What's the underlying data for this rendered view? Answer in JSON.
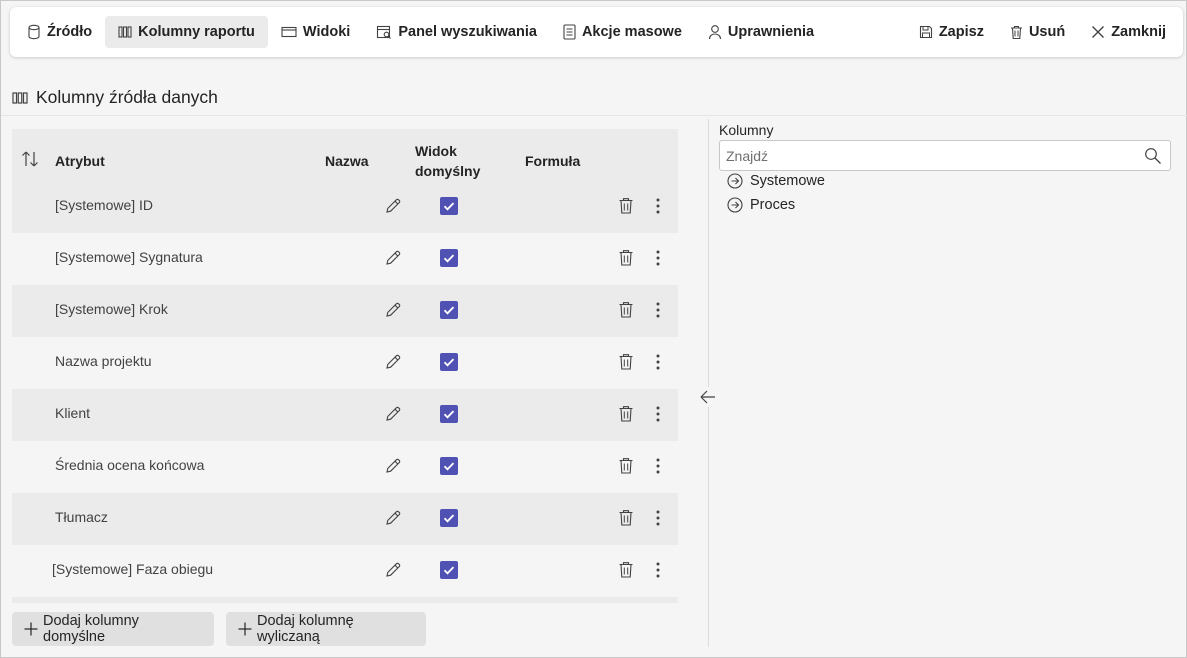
{
  "toolbar": {
    "items": [
      {
        "label": "Źródło",
        "icon": "database-icon"
      },
      {
        "label": "Kolumny raportu",
        "icon": "columns-icon",
        "active": true
      },
      {
        "label": "Widoki",
        "icon": "window-icon"
      },
      {
        "label": "Panel wyszukiwania",
        "icon": "calendar-search-icon"
      },
      {
        "label": "Akcje masowe",
        "icon": "list-document-icon"
      },
      {
        "label": "Uprawnienia",
        "icon": "person-icon"
      }
    ],
    "right_items": [
      {
        "label": "Zapisz",
        "icon": "save-icon"
      },
      {
        "label": "Usuń",
        "icon": "delete-icon"
      },
      {
        "label": "Zamknij",
        "icon": "close-icon"
      }
    ]
  },
  "section": {
    "title": "Kolumny źródła danych",
    "icon": "columns-icon"
  },
  "table": {
    "headers": {
      "attribute": "Atrybut",
      "name": "Nazwa",
      "default_view_line1": "Widok",
      "default_view_line2": "domyślny",
      "formula": "Formuła"
    },
    "rows": [
      {
        "attribute": "[Systemowe] ID",
        "default_view": true
      },
      {
        "attribute": "[Systemowe] Sygnatura",
        "default_view": true
      },
      {
        "attribute": "[Systemowe] Krok",
        "default_view": true
      },
      {
        "attribute": "Nazwa projektu",
        "default_view": true
      },
      {
        "attribute": "Klient",
        "default_view": true
      },
      {
        "attribute": "Średnia ocena końcowa",
        "default_view": true
      },
      {
        "attribute": "Tłumacz",
        "default_view": true
      },
      {
        "attribute": "[Systemowe] Faza obiegu",
        "default_view": true
      }
    ]
  },
  "buttons": {
    "add_default": "Dodaj kolumny domyślne",
    "add_calculated": "Dodaj kolumnę wyliczaną"
  },
  "right_panel": {
    "label": "Kolumny",
    "search_placeholder": "Znajdź",
    "tree": [
      {
        "label": "Systemowe"
      },
      {
        "label": "Proces"
      }
    ]
  },
  "colors": {
    "accent": "#4f52b2",
    "row_alt": "#f5f5f5",
    "row": "#ebebeb"
  }
}
